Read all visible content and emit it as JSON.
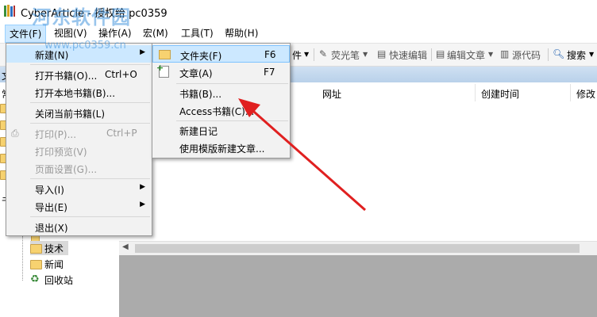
{
  "window": {
    "title": "CyberArticle - 授权给 pc0359"
  },
  "watermark": {
    "line1": "河东软件园",
    "line2": "www.pc0359.cn"
  },
  "menubar": {
    "file": "文件(F)",
    "view": "视图(V)",
    "operate": "操作(A)",
    "macro": "宏(M)",
    "tools": "工具(T)",
    "help": "帮助(H)"
  },
  "toolbar": {
    "file_partial": "件",
    "highlighter": "荧光笔",
    "quick_edit": "快速编辑",
    "edit_article": "编辑文章",
    "source": "源代码",
    "search": "搜索"
  },
  "left_partial": {
    "a": "文",
    "b": "常",
    "c": "书"
  },
  "table": {
    "columns": [
      "网址",
      "创建时间",
      "修改"
    ]
  },
  "tree": {
    "items": [
      "技术",
      "新闻",
      "回收站"
    ]
  },
  "file_menu": {
    "items": [
      {
        "label": "新建(N)",
        "shortcut": "",
        "submenu": true,
        "state": "highlighted"
      },
      {
        "label": "打开书籍(O)...",
        "shortcut": "Ctrl+O",
        "submenu": false,
        "state": "normal"
      },
      {
        "label": "打开本地书籍(B)...",
        "shortcut": "",
        "submenu": false,
        "state": "normal"
      },
      {
        "label": "关闭当前书籍(L)",
        "shortcut": "",
        "submenu": false,
        "state": "normal"
      },
      {
        "label": "打印(P)...",
        "shortcut": "Ctrl+P",
        "submenu": false,
        "state": "disabled"
      },
      {
        "label": "打印预览(V)",
        "shortcut": "",
        "submenu": false,
        "state": "disabled"
      },
      {
        "label": "页面设置(G)...",
        "shortcut": "",
        "submenu": false,
        "state": "disabled"
      },
      {
        "label": "导入(I)",
        "shortcut": "",
        "submenu": true,
        "state": "normal"
      },
      {
        "label": "导出(E)",
        "shortcut": "",
        "submenu": true,
        "state": "normal"
      },
      {
        "label": "退出(X)",
        "shortcut": "",
        "submenu": false,
        "state": "normal"
      }
    ]
  },
  "new_submenu": {
    "items": [
      {
        "label": "文件夹(F)",
        "shortcut": "F6"
      },
      {
        "label": "文章(A)",
        "shortcut": "F7"
      },
      {
        "label": "书籍(B)...",
        "shortcut": ""
      },
      {
        "label": "Access书籍(C)...",
        "shortcut": ""
      },
      {
        "label": "新建日记",
        "shortcut": ""
      },
      {
        "label": "使用模版新建文章...",
        "shortcut": ""
      }
    ]
  },
  "colors": {
    "highlight": "#cce8ff",
    "arrow": "#e02020",
    "folder": "#f7d270"
  }
}
